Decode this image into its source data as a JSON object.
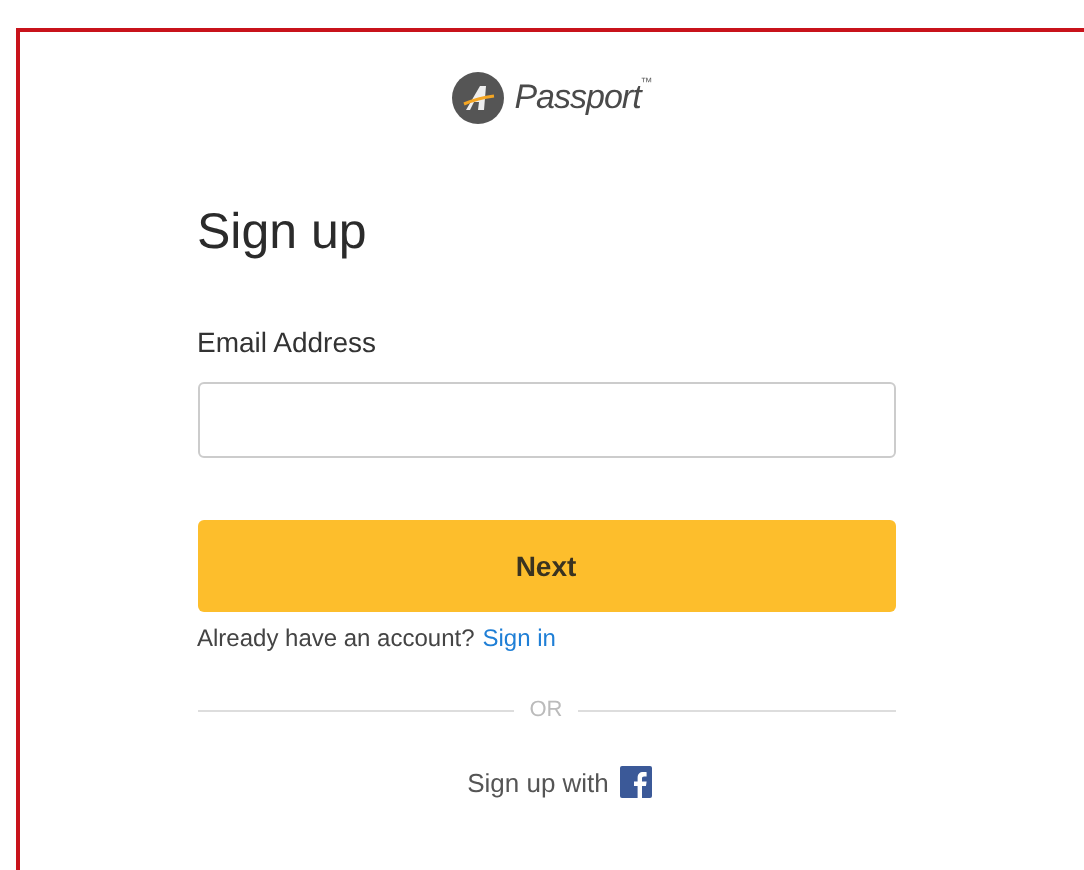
{
  "logo": {
    "name": "Passport",
    "trademark": "™"
  },
  "title": "Sign up",
  "email": {
    "label": "Email Address"
  },
  "next_button": "Next",
  "signin": {
    "prompt": "Already have an account?",
    "link": "Sign in"
  },
  "divider": "OR",
  "social": {
    "label": "Sign up with"
  }
}
